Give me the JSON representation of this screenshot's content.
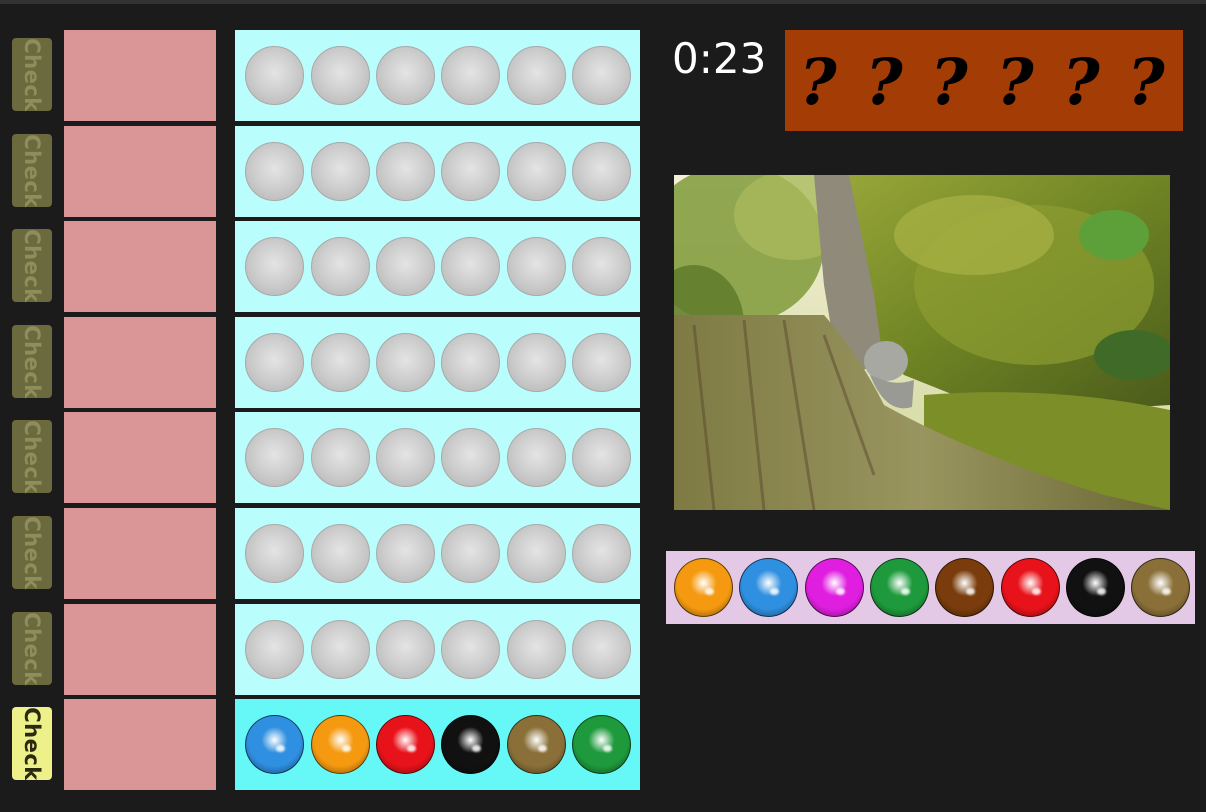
{
  "timer": "0:23",
  "check_label": "Check",
  "secret_code": [
    "?",
    "?",
    "?",
    "?",
    "?",
    "?"
  ],
  "colors": {
    "orange": "#f59a10",
    "blue": "#2f8fe0",
    "magenta": "#e01ee0",
    "green": "#1e9a3c",
    "brown": "#7a3c0c",
    "red": "#e8121a",
    "black": "#111111",
    "olive": "#8a7038"
  },
  "board": {
    "rows": [
      {
        "check_enabled": false,
        "pegs": [
          null,
          null,
          null,
          null,
          null,
          null
        ]
      },
      {
        "check_enabled": false,
        "pegs": [
          null,
          null,
          null,
          null,
          null,
          null
        ]
      },
      {
        "check_enabled": false,
        "pegs": [
          null,
          null,
          null,
          null,
          null,
          null
        ]
      },
      {
        "check_enabled": false,
        "pegs": [
          null,
          null,
          null,
          null,
          null,
          null
        ]
      },
      {
        "check_enabled": false,
        "pegs": [
          null,
          null,
          null,
          null,
          null,
          null
        ]
      },
      {
        "check_enabled": false,
        "pegs": [
          null,
          null,
          null,
          null,
          null,
          null
        ]
      },
      {
        "check_enabled": false,
        "pegs": [
          null,
          null,
          null,
          null,
          null,
          null
        ]
      },
      {
        "check_enabled": true,
        "pegs": [
          "blue",
          "orange",
          "red",
          "black",
          "olive",
          "green"
        ]
      }
    ]
  },
  "palette": [
    "orange",
    "blue",
    "magenta",
    "green",
    "brown",
    "red",
    "black",
    "olive"
  ],
  "picture": {
    "subject": "mossy tree stump with small stone statue"
  }
}
